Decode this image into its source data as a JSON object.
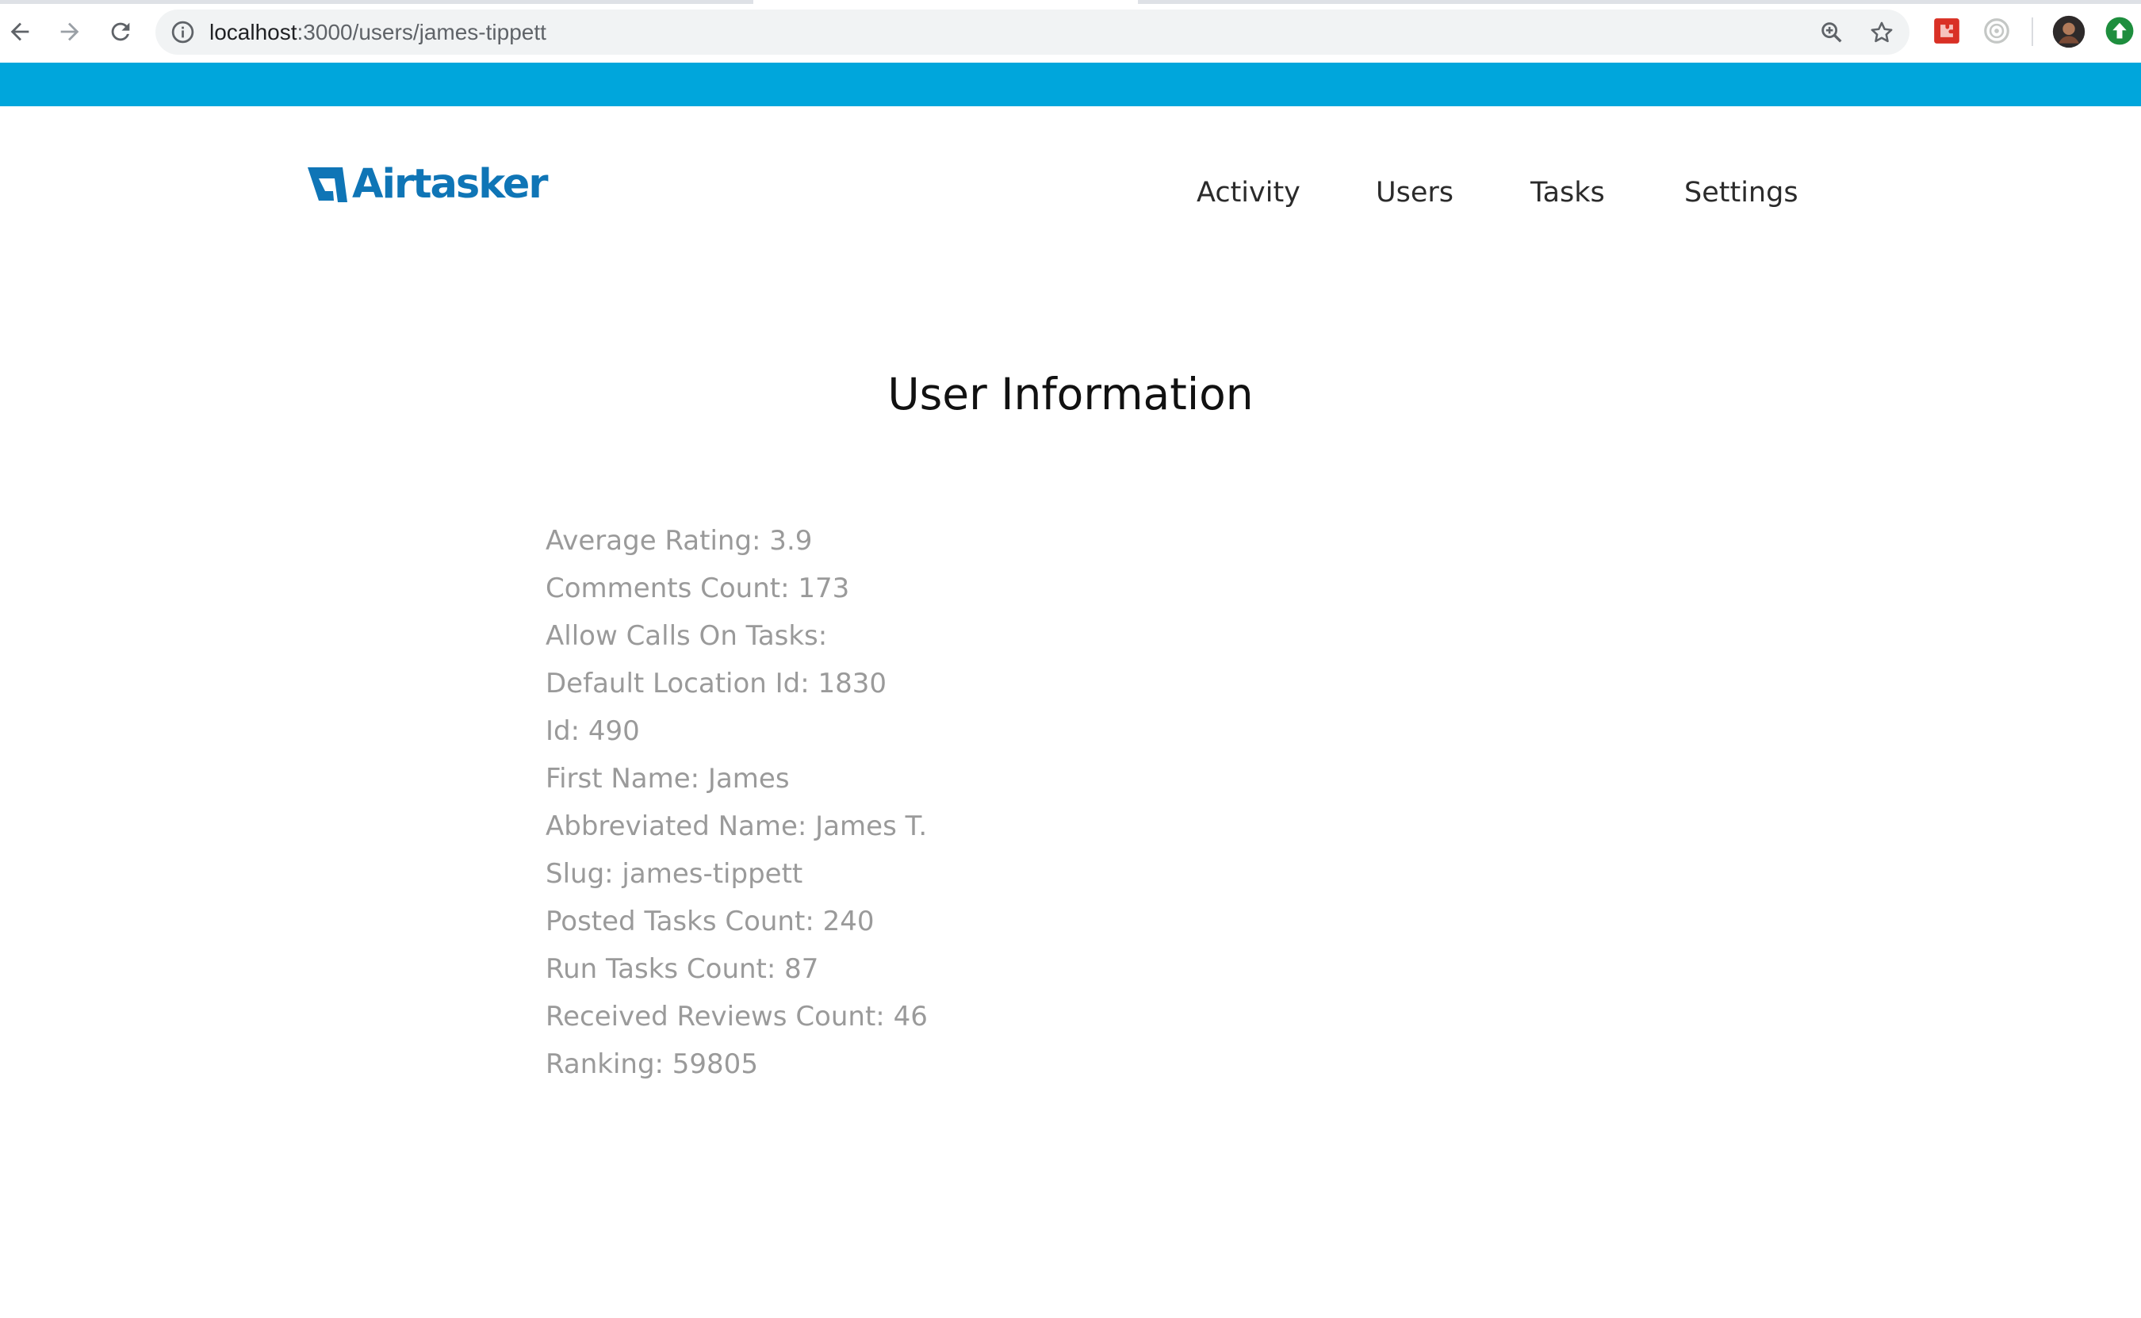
{
  "browser": {
    "url_host": "localhost",
    "url_path": ":3000/users/james-tippett"
  },
  "site": {
    "logo_text": "Airtasker",
    "brand_color": "#0f75b6",
    "band_color": "#00a6dc",
    "nav": [
      {
        "label": "Activity"
      },
      {
        "label": "Users"
      },
      {
        "label": "Tasks"
      },
      {
        "label": "Settings"
      }
    ]
  },
  "main": {
    "title": "User Information",
    "fields": [
      {
        "text": "Average Rating: 3.9"
      },
      {
        "text": "Comments Count: 173"
      },
      {
        "text": "Allow Calls On Tasks:"
      },
      {
        "text": "Default Location Id: 1830"
      },
      {
        "text": "Id: 490"
      },
      {
        "text": "First Name: James"
      },
      {
        "text": "Abbreviated Name: James T."
      },
      {
        "text": "Slug: james-tippett"
      },
      {
        "text": "Posted Tasks Count: 240"
      },
      {
        "text": "Run Tasks Count: 87"
      },
      {
        "text": "Received Reviews Count: 46"
      },
      {
        "text": "Ranking: 59805"
      }
    ]
  }
}
